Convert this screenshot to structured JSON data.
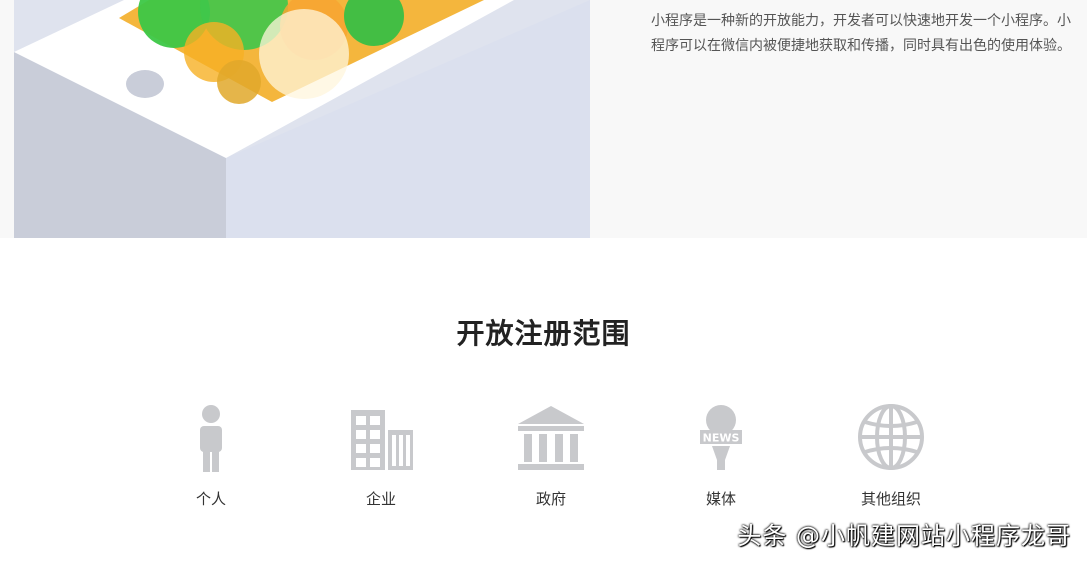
{
  "intro": {
    "text": "小程序是一种新的开放能力，开发者可以快速地开发一个小程序。小程序可以在微信内被便捷地获取和传播，同时具有出色的使用体验。"
  },
  "registration": {
    "title": "开放注册范围",
    "items": [
      {
        "label": "个人",
        "icon": "person-icon"
      },
      {
        "label": "企业",
        "icon": "building-icon"
      },
      {
        "label": "政府",
        "icon": "government-icon"
      },
      {
        "label": "媒体",
        "icon": "news-microphone-icon"
      },
      {
        "label": "其他组织",
        "icon": "globe-icon"
      }
    ]
  },
  "icon_badge": {
    "news": "NEWS"
  },
  "watermark": {
    "text": "头条 @小帆建网站小程序龙哥"
  },
  "colors": {
    "icon_gray": "#c8c9cc",
    "green_bubble": "#35c23e",
    "orange_bubble": "#f5a623"
  }
}
